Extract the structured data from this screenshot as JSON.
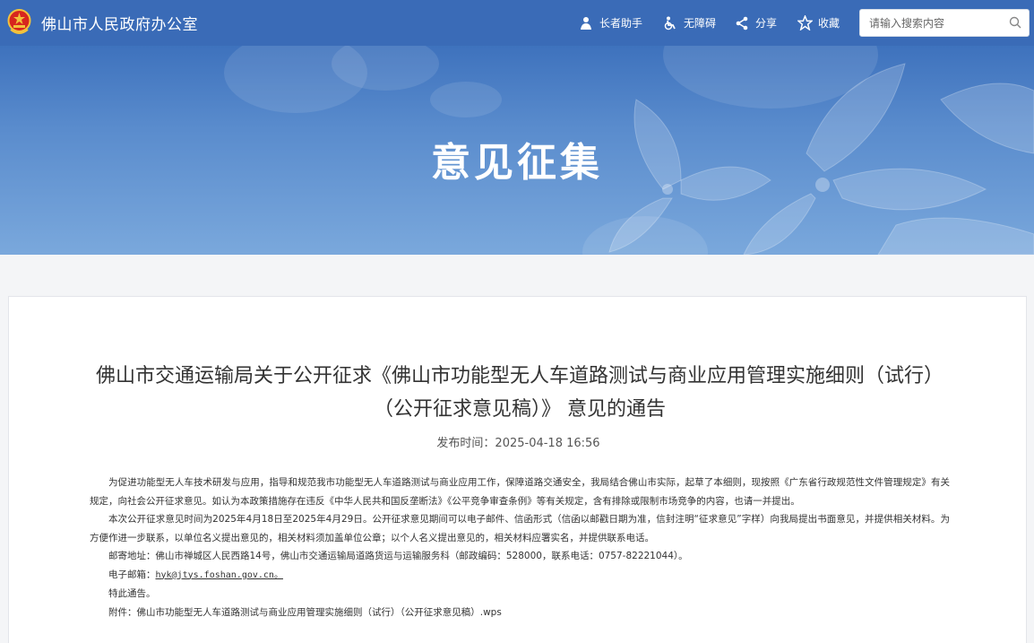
{
  "header": {
    "site_title": "佛山市人民政府办公室",
    "tools": [
      {
        "label": "长者助手",
        "icon": "elder-helper-icon"
      },
      {
        "label": "无障碍",
        "icon": "wheelchair-icon"
      },
      {
        "label": "分享",
        "icon": "share-icon"
      },
      {
        "label": "收藏",
        "icon": "star-icon"
      }
    ],
    "search": {
      "placeholder": "请输入搜索内容",
      "icon": "search-icon"
    }
  },
  "banner": {
    "title": "意见征集"
  },
  "article": {
    "title": "佛山市交通运输局关于公开征求《佛山市功能型无人车道路测试与商业应用管理实施细则（试行）（公开征求意见稿）》 意见的通告",
    "publish_time": "发布时间：2025-04-18 16:56",
    "para1": "为促进功能型无人车技术研发与应用，指导和规范我市功能型无人车道路测试与商业应用工作，保障道路交通安全，我局结合佛山市实际，起草了本细则，现按照《广东省行政规范性文件管理规定》有关规定，向社会公开征求意见。如认为本政策措施存在违反《中华人民共和国反垄断法》《公平竞争审查条例》等有关规定，含有排除或限制市场竞争的内容，也请一并提出。",
    "para2": "本次公开征求意见时间为2025年4月18日至2025年4月29日。公开征求意见期间可以电子邮件、信函形式（信函以邮戳日期为准，信封注明“征求意见”字样）向我局提出书面意见，并提供相关材料。为方便作进一步联系，以单位名义提出意见的，相关材料须加盖单位公章；以个人名义提出意见的，相关材料应署实名，并提供联系电话。",
    "address": "邮寄地址：佛山市禅城区人民西路14号，佛山市交通运输局道路货运与运输服务科（邮政编码：528000，联系电话：0757-82221044）。",
    "email_label": "电子邮箱：",
    "email": "hyk@jtys.foshan.gov.cn。",
    "closing": "特此通告。",
    "attachment": "附件：佛山市功能型无人车道路测试与商业应用管理实施细则（试行）（公开征求意见稿）.wps"
  },
  "colors": {
    "topbar": "#3a6bb7",
    "banner": "#5a8ccd",
    "page_bg": "#f4f5f7"
  }
}
